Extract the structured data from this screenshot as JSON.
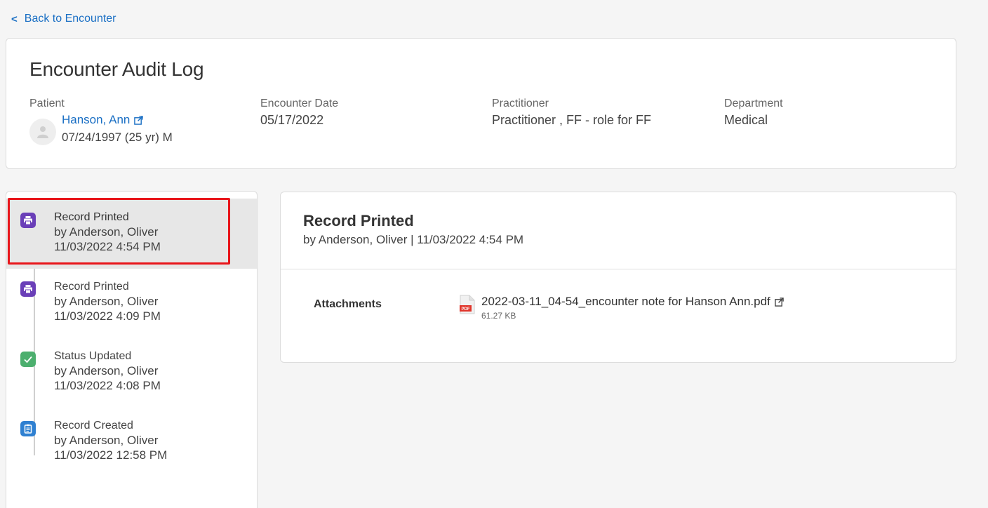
{
  "nav": {
    "back_label": "Back to Encounter"
  },
  "header": {
    "title": "Encounter Audit Log",
    "patient": {
      "label": "Patient",
      "name": "Hanson, Ann",
      "dob_line": "07/24/1997 (25 yr) M"
    },
    "encounter_date": {
      "label": "Encounter Date",
      "value": "05/17/2022"
    },
    "practitioner": {
      "label": "Practitioner",
      "value": "Practitioner , FF - role for FF"
    },
    "department": {
      "label": "Department",
      "value": "Medical"
    }
  },
  "timeline": {
    "items": [
      {
        "title": "Record Printed",
        "by": "by Anderson, Oliver",
        "time": "11/03/2022 4:54 PM",
        "icon": "printer-icon",
        "color": "#6a3fb8",
        "selected": true
      },
      {
        "title": "Record Printed",
        "by": "by Anderson, Oliver",
        "time": "11/03/2022 4:09 PM",
        "icon": "printer-icon",
        "color": "#6a3fb8",
        "selected": false
      },
      {
        "title": "Status Updated",
        "by": "by Anderson, Oliver",
        "time": "11/03/2022 4:08 PM",
        "icon": "check-icon",
        "color": "#4caf6e",
        "selected": false
      },
      {
        "title": "Record Created",
        "by": "by Anderson, Oliver",
        "time": "11/03/2022 12:58 PM",
        "icon": "clipboard-icon",
        "color": "#2f80d1",
        "selected": false
      }
    ]
  },
  "detail": {
    "title": "Record Printed",
    "subtitle": "by Anderson, Oliver | 11/03/2022 4:54 PM",
    "attachments_label": "Attachments",
    "attachment": {
      "file_name": "2022-03-11_04-54_encounter note for Hanson Ann.pdf",
      "size": "61.27 KB",
      "icon": "pdf-icon"
    }
  },
  "colors": {
    "link": "#1a6fc4",
    "highlight": "#e8161b"
  }
}
